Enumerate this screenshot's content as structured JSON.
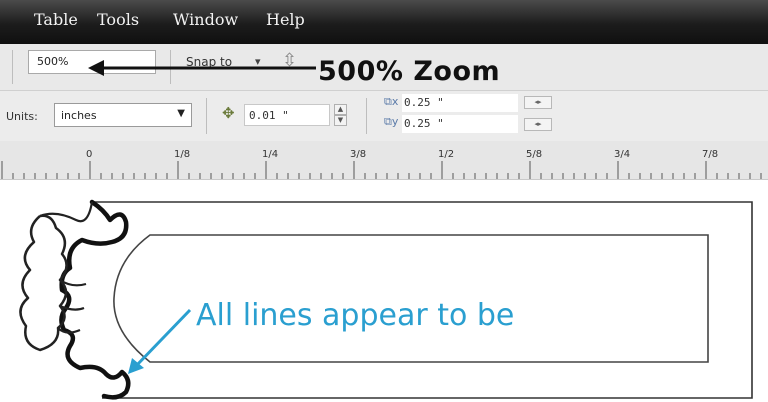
{
  "menu": {
    "items": [
      "Table",
      "Tools",
      "Window",
      "Help"
    ]
  },
  "toolbar": {
    "zoom_value": "500%",
    "snap_label": "Snap to",
    "annotation_zoom": "500% Zoom"
  },
  "property_bar": {
    "units_label": "Units:",
    "units_value": "inches",
    "nudge_value": "0.01 \"",
    "duplicate_x": "0.25 \"",
    "duplicate_y": "0.25 \""
  },
  "ruler": {
    "labels": [
      "0",
      "1/8",
      "1/4",
      "3/8",
      "1/2",
      "5/8",
      "3/4",
      "7/8"
    ]
  },
  "canvas": {
    "annotation_lines": "All lines appear to be"
  },
  "colors": {
    "annotation_blue": "#2a9fd0",
    "menubar": "#1c1c1c"
  }
}
